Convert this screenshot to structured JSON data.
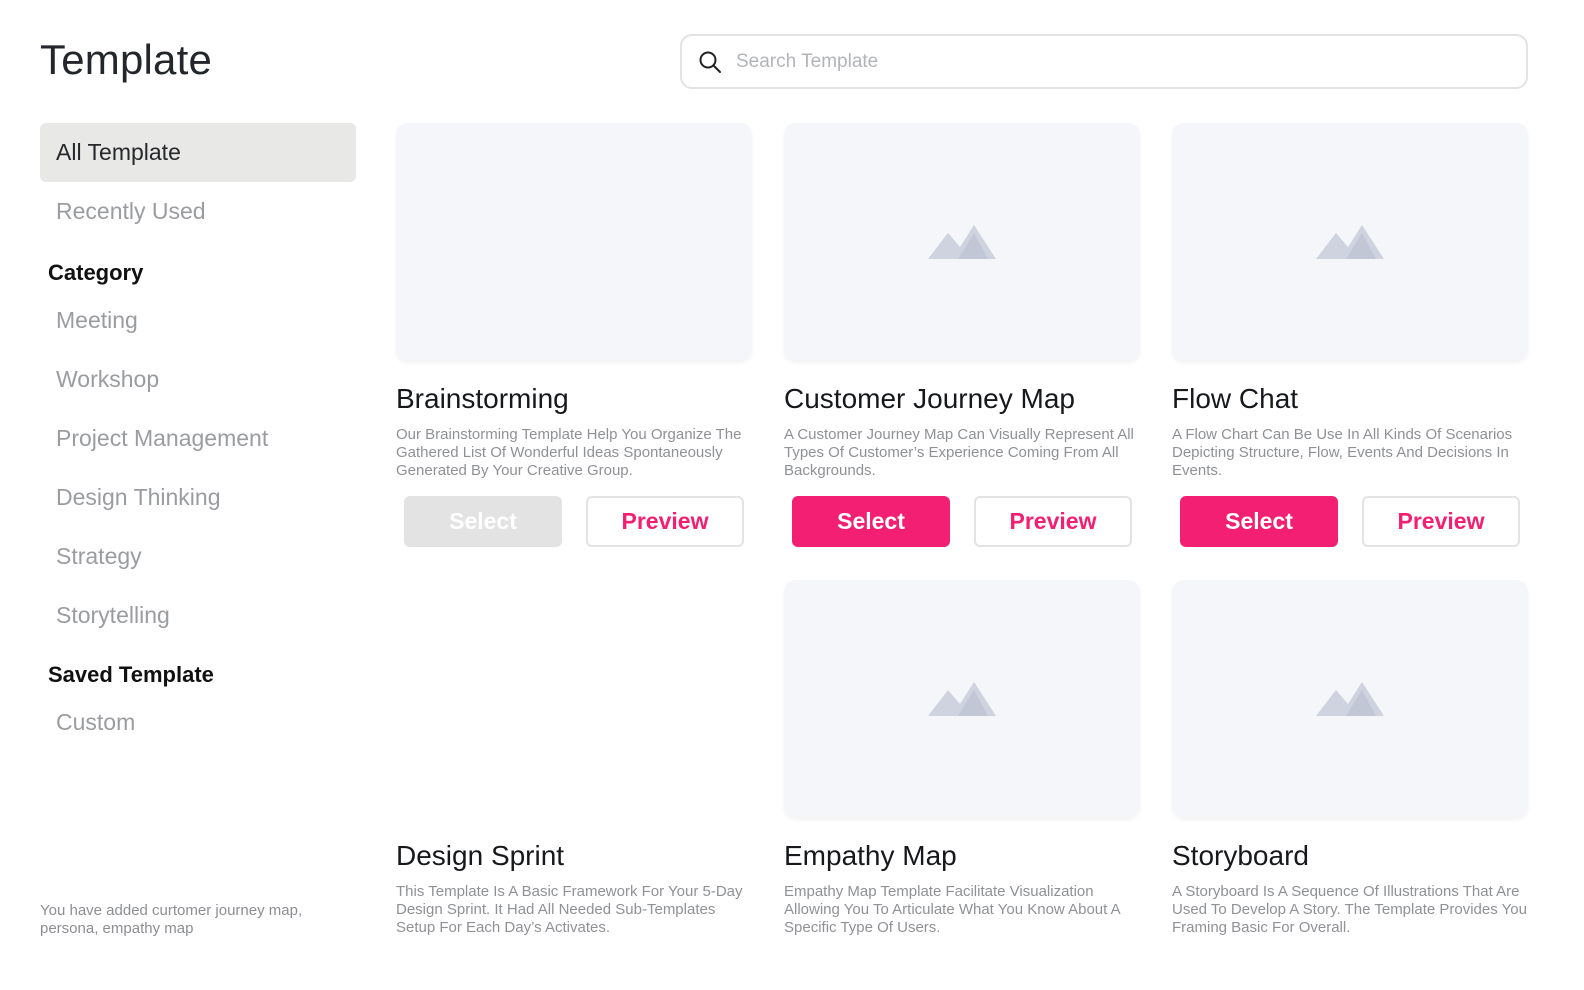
{
  "header": {
    "title": "Template",
    "search_placeholder": "Search Template",
    "search_value": ""
  },
  "sidebar": {
    "top_items": [
      {
        "label": "All Template",
        "active": true
      },
      {
        "label": "Recently Used",
        "active": false
      }
    ],
    "category_heading": "Category",
    "categories": [
      "Meeting",
      "Workshop",
      "Project Management",
      "Design Thinking",
      "Strategy",
      "Storytelling"
    ],
    "saved_heading": "Saved Template",
    "saved": [
      "Custom"
    ],
    "footnote": "You have added curtomer journey map, persona, empathy map"
  },
  "cards": [
    {
      "title": "Brainstorming",
      "desc": "Our Brainstorming Template Help You Organize The Gathered List Of Wonderful Ideas Spontaneously Generated By Your Creative Group.",
      "select_label": "Select",
      "preview_label": "Preview",
      "select_enabled": false
    },
    {
      "title": "Customer Journey Map",
      "desc": "A Customer Journey Map Can Visually Represent All Types Of Customer’s Experience Coming From All Backgrounds.",
      "select_label": "Select",
      "preview_label": "Preview",
      "select_enabled": true
    },
    {
      "title": "Flow Chat",
      "desc": "A Flow Chart Can Be Use In All Kinds Of Scenarios Depicting Structure, Flow, Events And Decisions In Events.",
      "select_label": "Select",
      "preview_label": "Preview",
      "select_enabled": true
    },
    {
      "title": "Design Sprint",
      "desc": "This Template Is A Basic Framework For Your 5-Day Design Sprint. It Had All Needed Sub-Templates Setup For Each Day’s Activates."
    },
    {
      "title": "Empathy Map",
      "desc": "Empathy Map Template Facilitate Visualization Allowing You To Articulate What You Know About A Specific Type Of Users."
    },
    {
      "title": "Storyboard",
      "desc": "A Storyboard Is A Sequence Of Illustrations That Are Used To Develop A Story. The Template Provides You Framing Basic For Overall."
    }
  ],
  "colors": {
    "accent": "#f21f72",
    "disabled": "#e3e3e3",
    "thumb_bg": "#f5f6fa",
    "image_icon": "#cfd3df"
  }
}
